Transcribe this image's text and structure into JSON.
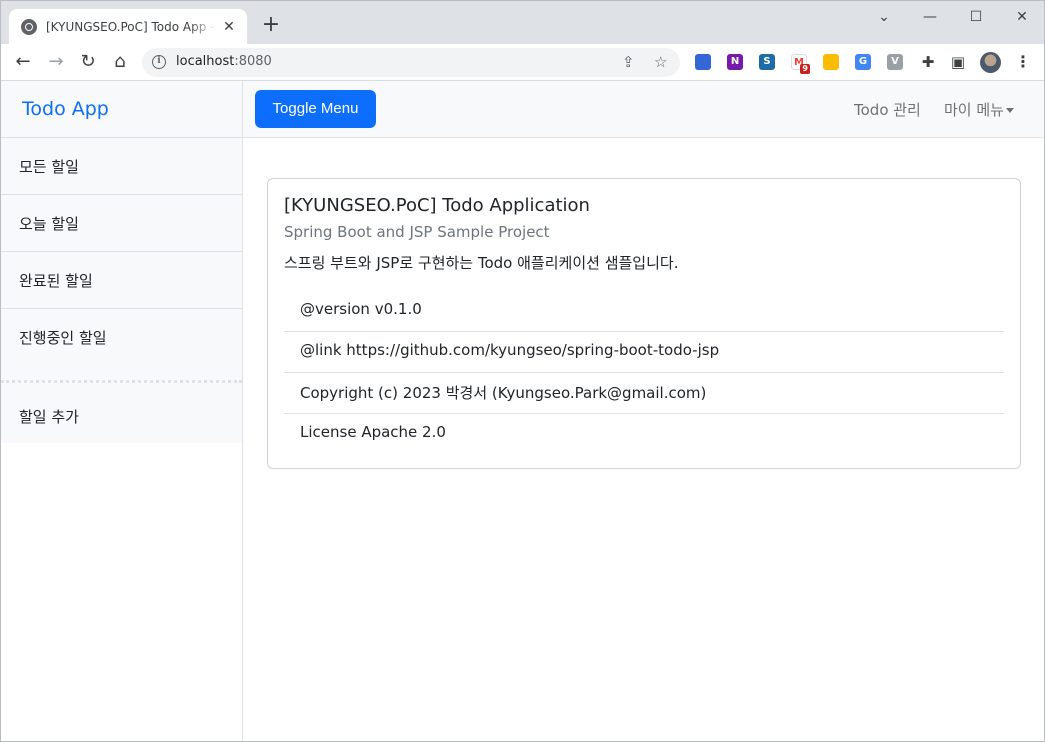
{
  "browser": {
    "tab_title": "[KYUNGSEO.PoC] Todo App - Spring Boot and JSP Sample Project",
    "new_tab": "+",
    "url_host": "localhost",
    "url_port": ":8080",
    "extensions": [
      {
        "name": "download-extension-icon",
        "color": "#3367d6"
      },
      {
        "name": "onenote-extension-icon",
        "color": "#7719aa",
        "glyph": "N"
      },
      {
        "name": "s-extension-icon",
        "color": "#1f6ba5",
        "glyph": "S"
      },
      {
        "name": "gmail-extension-icon",
        "color": "#ffffff",
        "glyph": "M",
        "badge": "9"
      },
      {
        "name": "keep-extension-icon",
        "color": "#fbbc04"
      },
      {
        "name": "translate-extension-icon",
        "color": "#4285f4",
        "glyph": "G"
      },
      {
        "name": "vue-extension-icon",
        "color": "#9aa0a6",
        "glyph": "V"
      }
    ]
  },
  "sidebar": {
    "heading": "Todo App",
    "items": [
      {
        "label": "모든 할일"
      },
      {
        "label": "오늘 할일"
      },
      {
        "label": "완료된 할일"
      },
      {
        "label": "진행중인 할일"
      }
    ],
    "add_label": "할일 추가"
  },
  "topnav": {
    "toggle_label": "Toggle Menu",
    "todo_manage": "Todo 관리",
    "my_menu": "마이 메뉴"
  },
  "card": {
    "title": "[KYUNGSEO.PoC] Todo Application",
    "subtitle": "Spring Boot and JSP Sample Project",
    "text": "스프링 부트와 JSP로 구현하는 Todo 애플리케이션 샘플입니다.",
    "list": [
      "@version v0.1.0",
      "@link https://github.com/kyungseo/spring-boot-todo-jsp",
      "Copyright (c) 2023 박경서 (Kyungseo.Park@gmail.com)",
      "License Apache 2.0"
    ]
  },
  "colors": {
    "primary": "#0d6efd",
    "light_bg": "#f8f9fa",
    "muted": "#6c757d"
  }
}
